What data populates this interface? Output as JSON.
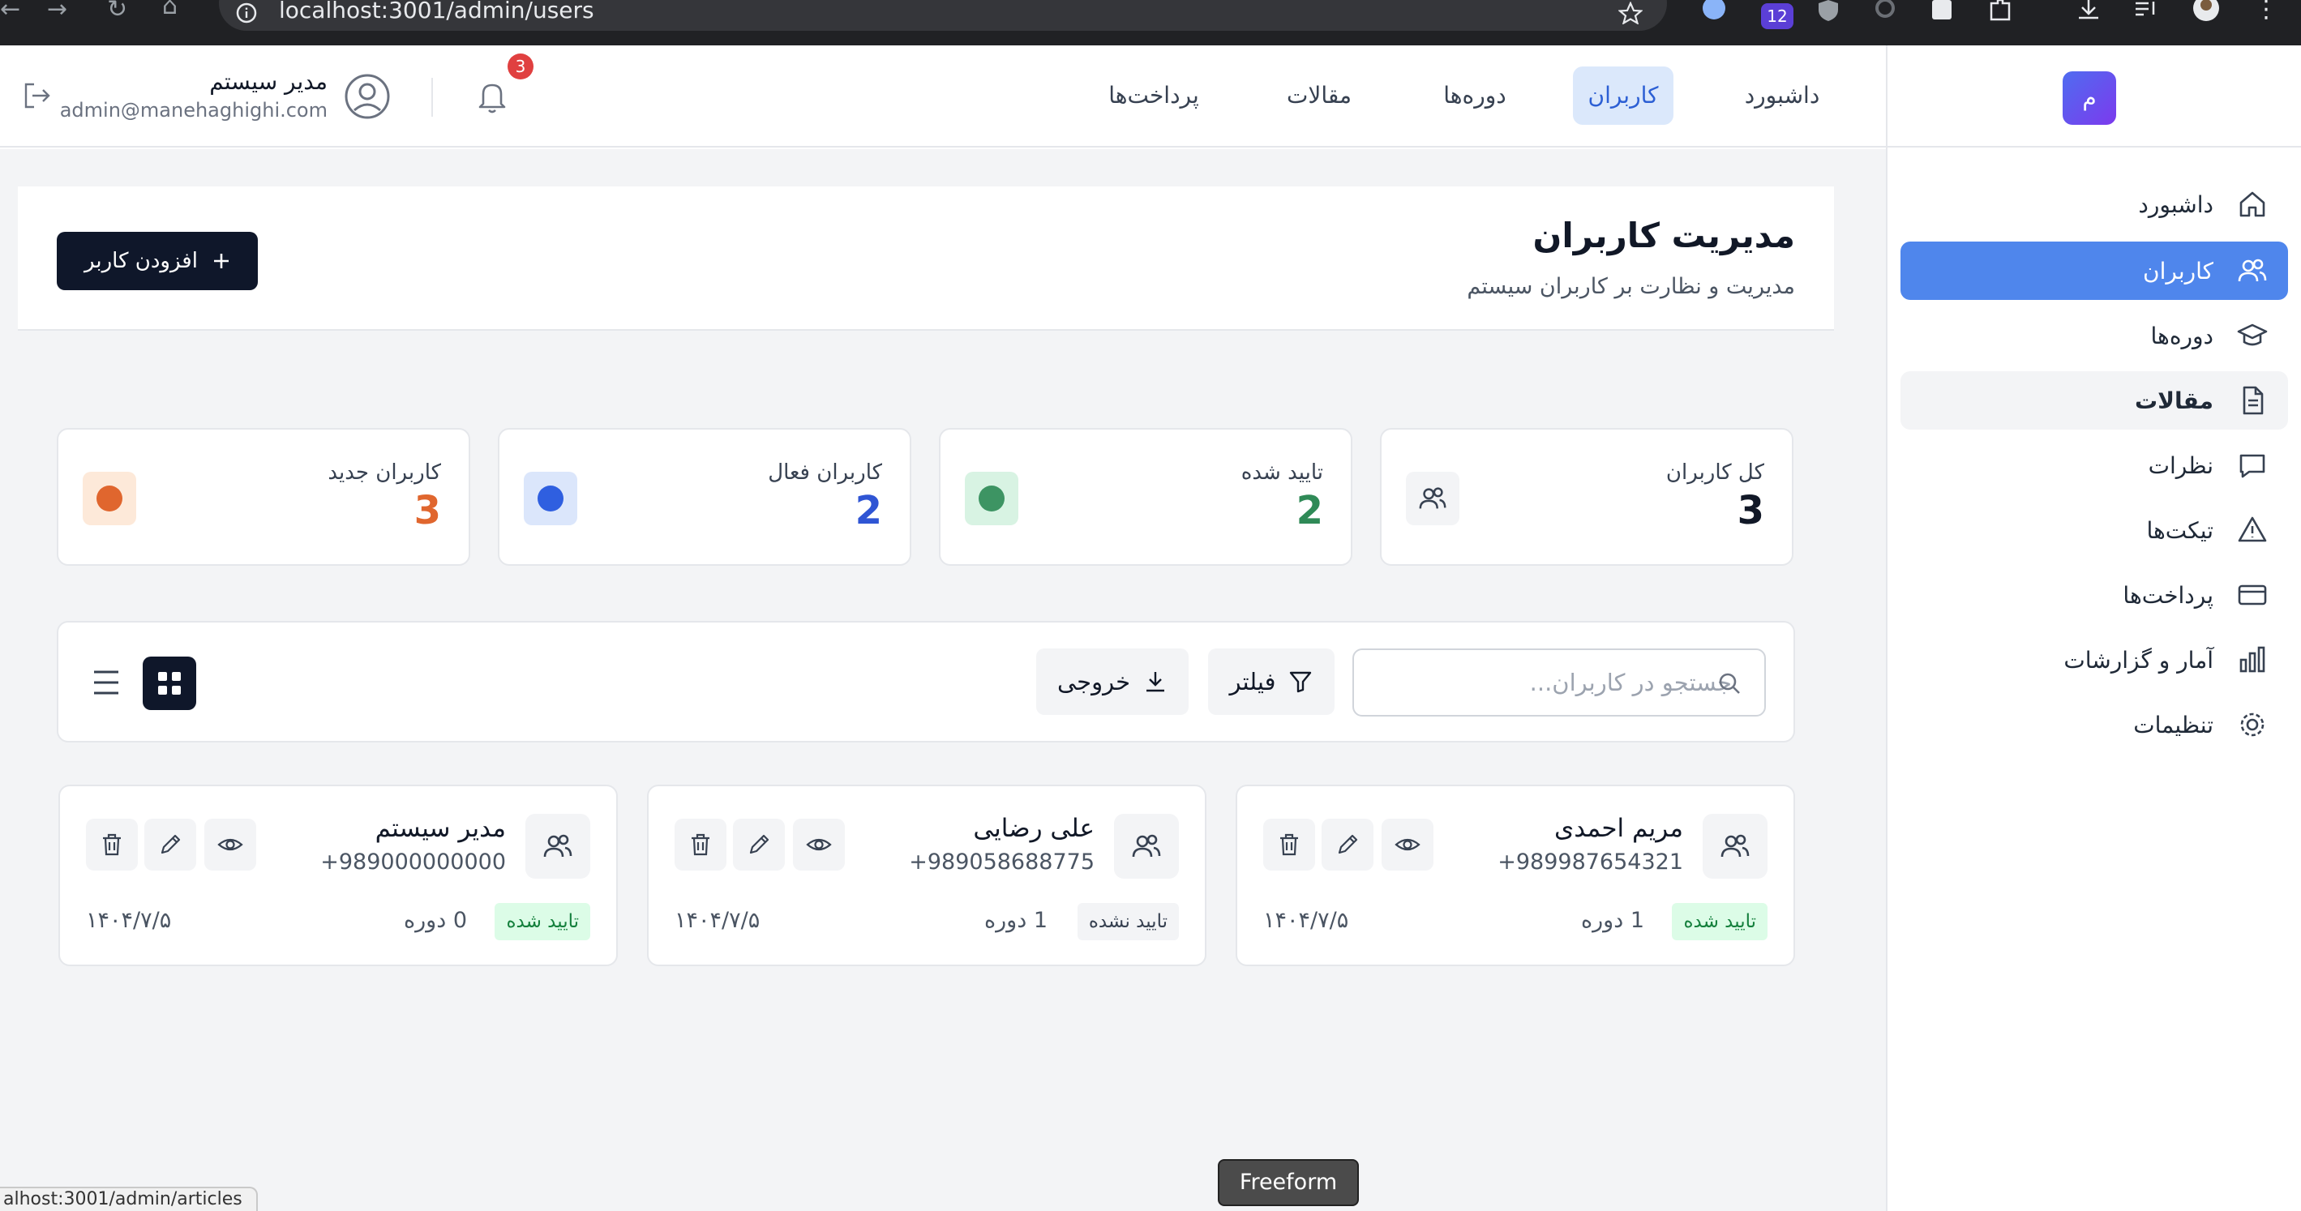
{
  "browser": {
    "url": "localhost:3001/admin/users",
    "extension_badge": "12"
  },
  "sidebar": {
    "brand_letter": "م",
    "items": [
      {
        "label": "داشبورد",
        "icon": "home-icon"
      },
      {
        "label": "کاربران",
        "icon": "users-icon"
      },
      {
        "label": "دوره‌ها",
        "icon": "graduation-cap-icon"
      },
      {
        "label": "مقالات",
        "icon": "document-icon"
      },
      {
        "label": "نظرات",
        "icon": "chat-icon"
      },
      {
        "label": "تیکت‌ها",
        "icon": "warning-icon"
      },
      {
        "label": "پرداخت‌ها",
        "icon": "credit-card-icon"
      },
      {
        "label": "آمار و گزارشات",
        "icon": "bar-chart-icon"
      },
      {
        "label": "تنظیمات",
        "icon": "gear-icon"
      }
    ]
  },
  "header": {
    "nav": [
      "داشبورد",
      "کاربران",
      "دوره‌ها",
      "مقالات",
      "پرداخت‌ها"
    ],
    "active_nav": "کاربران",
    "user_name": "مدیر سیستم",
    "user_email": "admin@manehaghighi.com",
    "notification_count": "3"
  },
  "page": {
    "title": "مدیریت کاربران",
    "subtitle": "مدیریت و نظارت بر کاربران سیستم",
    "add_button": "افزودن کاربر"
  },
  "stats": [
    {
      "label": "کل کاربران",
      "value": "3",
      "color": "#111827",
      "icon": "users-icon"
    },
    {
      "label": "تایید شده",
      "value": "2",
      "color": "#2f8a57",
      "dot": "#3d9463",
      "dot_bg": "#d8f3e3"
    },
    {
      "label": "کاربران فعال",
      "value": "2",
      "color": "#2f55d4",
      "dot": "#2f5fe0",
      "dot_bg": "#dbe6fb"
    },
    {
      "label": "کاربران جدید",
      "value": "3",
      "color": "#e0662e",
      "dot": "#e0662e",
      "dot_bg": "#fde9d9"
    }
  ],
  "toolbar": {
    "search_placeholder": "جستجو در کاربران...",
    "filter_label": "فیلتر",
    "export_label": "خروجی"
  },
  "users": [
    {
      "name": "مریم احمدی",
      "phone": "+989987654321",
      "status": "تایید شده",
      "verified": true,
      "courses": "1 دوره",
      "date": "۱۴۰۴/۷/۵"
    },
    {
      "name": "علی رضایی",
      "phone": "+989058688775",
      "status": "تایید نشده",
      "verified": false,
      "courses": "1 دوره",
      "date": "۱۴۰۴/۷/۵"
    },
    {
      "name": "مدیر سیستم",
      "phone": "+989000000000",
      "status": "تایید شده",
      "verified": true,
      "courses": "0 دوره",
      "date": "۱۴۰۴/۷/۵"
    }
  ],
  "overlay": {
    "tooltip": "Freeform",
    "status_url": "alhost:3001/admin/articles"
  }
}
